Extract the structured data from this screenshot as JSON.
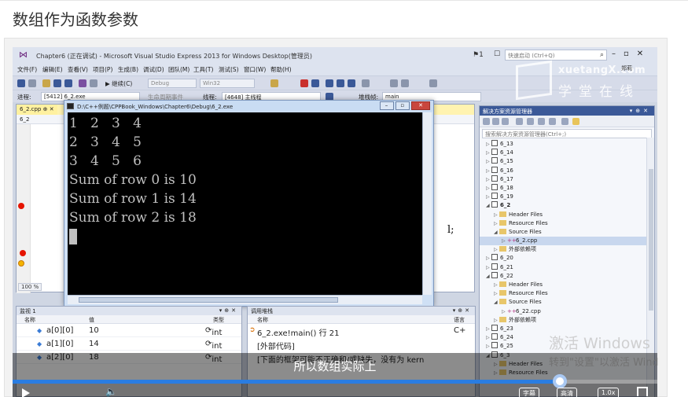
{
  "page": {
    "title": "数组作为函数参数"
  },
  "ide": {
    "window_title": "Chapter6 (正在调试) - Microsoft Visual Studio Express 2013 for Windows Desktop(管理员)",
    "notification_count": "1",
    "quick_launch_placeholder": "快速启动 (Ctrl+Q)",
    "user": "郑莉",
    "menu": [
      "文件(F)",
      "编辑(E)",
      "查看(V)",
      "项目(P)",
      "生成(B)",
      "调试(D)",
      "团队(M)",
      "工具(T)",
      "测试(S)",
      "窗口(W)",
      "帮助(H)"
    ],
    "toolbar": {
      "continue_label": "继续(C)",
      "config_value": "Debug",
      "platform_value": "Win32"
    },
    "debug_bar": {
      "process_label": "进程:",
      "process_value": "[5412] 6_2.exe",
      "lifecycle_label": "生命周期事件",
      "thread_label": "线程:",
      "thread_value": "[4648] 主线程",
      "stack_label": "堆栈帧:",
      "stack_value": "main"
    },
    "watermark": {
      "site": "xuetangX.com",
      "brand": "学堂在线"
    }
  },
  "editor": {
    "tab_label": "6_2.cpp",
    "scope_label": "6_2",
    "code_fragment": "l;",
    "zoom": "100 %"
  },
  "console": {
    "title": "D:\\C++例题\\CPPBook_Windows\\Chapter6\\Debug\\6_2.exe",
    "lines": [
      "1   2   3   4",
      "2   3   4   5",
      "3   4   5   6",
      "Sum of row 0 is 10",
      "Sum of row 1 is 14",
      "Sum of row 2 is 18"
    ]
  },
  "solution_explorer": {
    "title": "解决方案资源管理器",
    "search_placeholder": "搜索解决方案资源管理器(Ctrl+;)",
    "items": [
      {
        "label": "6_13",
        "kind": "project",
        "depth": 0
      },
      {
        "label": "6_14",
        "kind": "project",
        "depth": 0
      },
      {
        "label": "6_15",
        "kind": "project",
        "depth": 0
      },
      {
        "label": "6_16",
        "kind": "project",
        "depth": 0
      },
      {
        "label": "6_17",
        "kind": "project",
        "depth": 0
      },
      {
        "label": "6_18",
        "kind": "project",
        "depth": 0
      },
      {
        "label": "6_19",
        "kind": "project",
        "depth": 0
      },
      {
        "label": "6_2",
        "kind": "project",
        "depth": 0,
        "bold": true,
        "open": true
      },
      {
        "label": "Header Files",
        "kind": "folder",
        "depth": 1
      },
      {
        "label": "Resource Files",
        "kind": "folder",
        "depth": 1
      },
      {
        "label": "Source Files",
        "kind": "folder",
        "depth": 1,
        "open": true
      },
      {
        "label": "6_2.cpp",
        "kind": "file",
        "depth": 2,
        "selected": true
      },
      {
        "label": "外部依赖项",
        "kind": "folder",
        "depth": 1
      },
      {
        "label": "6_20",
        "kind": "project",
        "depth": 0
      },
      {
        "label": "6_21",
        "kind": "project",
        "depth": 0
      },
      {
        "label": "6_22",
        "kind": "project",
        "depth": 0,
        "open": true
      },
      {
        "label": "Header Files",
        "kind": "folder",
        "depth": 1
      },
      {
        "label": "Resource Files",
        "kind": "folder",
        "depth": 1
      },
      {
        "label": "Source Files",
        "kind": "folder",
        "depth": 1,
        "open": true
      },
      {
        "label": "6_22.cpp",
        "kind": "file",
        "depth": 2
      },
      {
        "label": "外部依赖项",
        "kind": "folder",
        "depth": 1
      },
      {
        "label": "6_23",
        "kind": "project",
        "depth": 0
      },
      {
        "label": "6_24",
        "kind": "project",
        "depth": 0
      },
      {
        "label": "6_25",
        "kind": "project",
        "depth": 0
      },
      {
        "label": "6_3",
        "kind": "project",
        "depth": 0,
        "open": true
      },
      {
        "label": "Header Files",
        "kind": "folder",
        "depth": 1
      },
      {
        "label": "Resource Files",
        "kind": "folder",
        "depth": 1
      }
    ]
  },
  "watch": {
    "title": "监视 1",
    "columns": [
      "名称",
      "值",
      "类型"
    ],
    "rows": [
      {
        "name": "a[0][0]",
        "value": "10",
        "type": "int"
      },
      {
        "name": "a[1][0]",
        "value": "14",
        "type": "int"
      },
      {
        "name": "a[2][0]",
        "value": "18",
        "type": "int"
      }
    ]
  },
  "call_stack": {
    "title": "调用堆栈",
    "columns": [
      "名称",
      "语言"
    ],
    "rows": [
      {
        "name": "6_2.exe!main() 行 21",
        "lang": "C+"
      },
      {
        "name": "[外部代码]",
        "lang": ""
      },
      {
        "name": "[下面的框架可能不正确和/或缺失，没有为 kern",
        "lang": ""
      }
    ]
  },
  "overlay": {
    "activate_title": "激活 Windows",
    "activate_sub": "转到\"设置\"以激活 Wind",
    "subtitle": "所以数组实际上"
  },
  "player": {
    "progress": 0.849,
    "buttons": [
      "字幕",
      "高清",
      "1.0x"
    ]
  }
}
